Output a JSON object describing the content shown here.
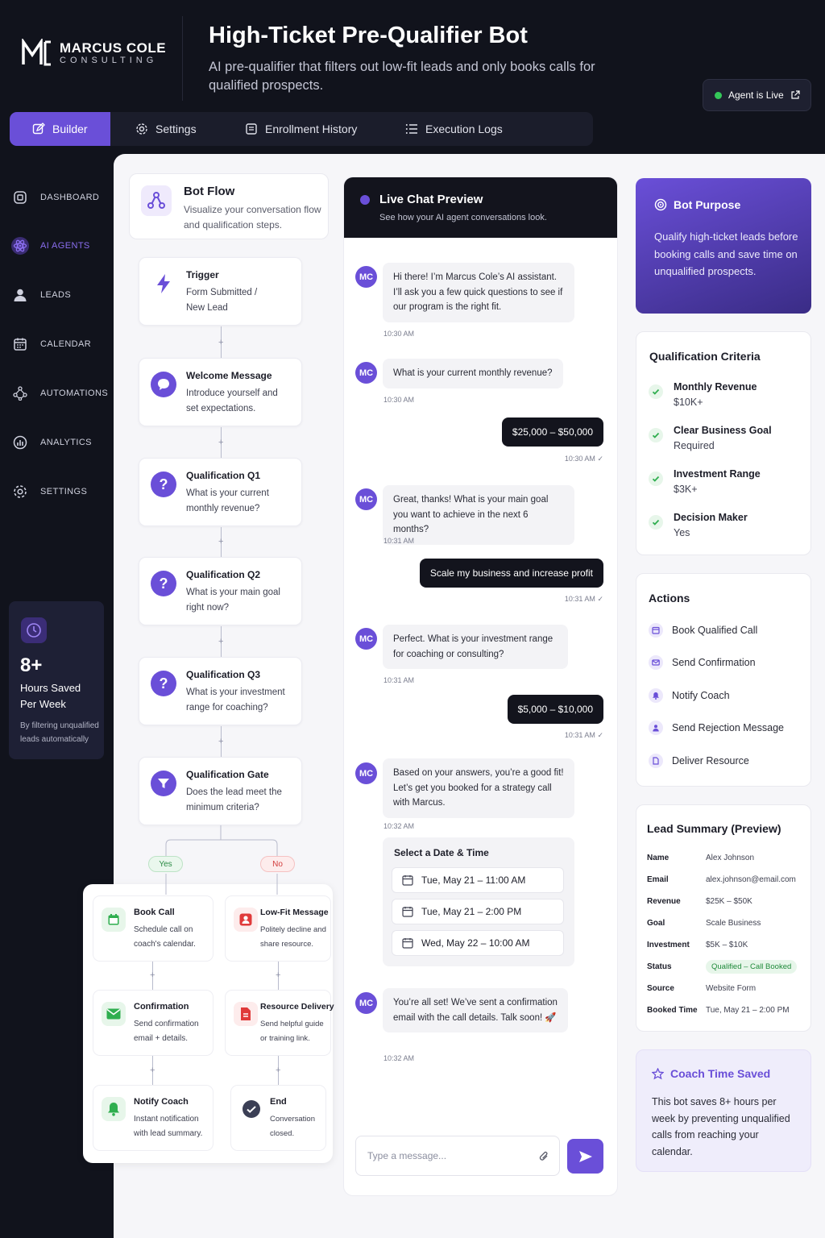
{
  "brand": {
    "name": "MARCUS COLE",
    "sub": "CONSULTING"
  },
  "header": {
    "title": "High-Ticket Pre-Qualifier Bot",
    "subtitle": "AI pre-qualifier that filters out low-fit leads and only books calls for qualified prospects.",
    "status": "Agent is Live"
  },
  "tabs": [
    {
      "label": "Builder",
      "icon": "edit-icon",
      "active": true
    },
    {
      "label": "Settings",
      "icon": "gear-icon"
    },
    {
      "label": "Enrollment History",
      "icon": "document-icon"
    },
    {
      "label": "Execution Logs",
      "icon": "list-icon"
    }
  ],
  "sidebar": {
    "items": [
      {
        "label": "DASHBOARD",
        "icon": "dashboard-icon"
      },
      {
        "label": "AI AGENTS",
        "icon": "atom-icon",
        "active": true
      },
      {
        "label": "LEADS",
        "icon": "user-icon"
      },
      {
        "label": "CALENDAR",
        "icon": "calendar-icon"
      },
      {
        "label": "AUTOMATIONS",
        "icon": "network-icon"
      },
      {
        "label": "ANALYTICS",
        "icon": "chart-icon"
      },
      {
        "label": "SETTINGS",
        "icon": "gear-icon"
      }
    ],
    "hours": {
      "value": "8+",
      "line1": "Hours Saved",
      "line2": "Per Week",
      "note": "By filtering unqualified leads automatically"
    }
  },
  "flow": {
    "title": "Bot Flow",
    "subtitle": "Visualize your conversation flow and qualification steps.",
    "steps": [
      {
        "title": "Trigger",
        "desc": "Form Submitted / New Lead",
        "icon": "bolt-icon"
      },
      {
        "title": "Welcome Message",
        "desc": "Introduce yourself and set expectations.",
        "icon": "chat-bubble-icon"
      },
      {
        "title": "Qualification Q1",
        "desc": "What is your current monthly revenue?",
        "icon": "question-icon"
      },
      {
        "title": "Qualification Q2",
        "desc": "What is your main goal right now?",
        "icon": "question-icon"
      },
      {
        "title": "Qualification Q3",
        "desc": "What is your investment range for coaching?",
        "icon": "question-icon"
      },
      {
        "title": "Qualification Gate",
        "desc": "Does the lead meet the minimum criteria?",
        "icon": "filter-icon"
      }
    ],
    "yes": "Yes",
    "no": "No",
    "yes_branch": [
      {
        "title": "Book Call",
        "desc": "Schedule call on coach's calendar.",
        "icon": "calendar-icon"
      },
      {
        "title": "Confirmation",
        "desc": "Send confirmation email + details.",
        "icon": "mail-icon"
      },
      {
        "title": "Notify Coach",
        "desc": "Instant notification with lead summary.",
        "icon": "bell-icon"
      }
    ],
    "no_branch": [
      {
        "title": "Low-Fit Message",
        "desc": "Politely decline and share resource.",
        "icon": "user-x-icon"
      },
      {
        "title": "Resource Delivery",
        "desc": "Send helpful guide or training link.",
        "icon": "file-icon"
      },
      {
        "title": "End",
        "desc": "Conversation closed.",
        "icon": "check-circle-icon"
      }
    ]
  },
  "chat": {
    "title": "Live Chat Preview",
    "subtitle": "See how your AI agent conversations look.",
    "avatar": "MC",
    "messages": [
      {
        "from": "bot",
        "text": "Hi there! I’m Marcus Cole’s AI assistant. I’ll ask you a few quick questions to see if our program is the right fit.",
        "time": "10:30 AM"
      },
      {
        "from": "bot",
        "text": "What is your current monthly revenue?",
        "time": "10:30 AM"
      },
      {
        "from": "user",
        "text": "$25,000 – $50,000",
        "time": "10:30 AM"
      },
      {
        "from": "bot",
        "text": "Great, thanks! What is your main goal you want to achieve in the next 6 months?",
        "time": "10:31 AM"
      },
      {
        "from": "user",
        "text": "Scale my business and increase profit",
        "time": "10:31 AM"
      },
      {
        "from": "bot",
        "text": "Perfect. What is your investment range for coaching or consulting?",
        "time": "10:31 AM"
      },
      {
        "from": "user",
        "text": "$5,000 – $10,000",
        "time": "10:31 AM"
      },
      {
        "from": "bot",
        "text": "Based on your answers, you’re a good fit! Let’s get you booked for a strategy call with Marcus.",
        "time": "10:32 AM"
      },
      {
        "from": "bot",
        "text": "You’re all set! We’ve sent a confirmation email with the call details. Talk soon! 🚀",
        "time": "10:32 AM"
      }
    ],
    "slots_title": "Select a Date & Time",
    "slots": [
      "Tue, May 21 – 11:00 AM",
      "Tue, May 21 – 2:00 PM",
      "Wed, May 22 – 10:00 AM"
    ],
    "input_placeholder": "Type a message..."
  },
  "purpose": {
    "title": "Bot Purpose",
    "body": "Qualify high-ticket leads before booking calls and save time on unqualified prospects."
  },
  "criteria": {
    "title": "Qualification Criteria",
    "items": [
      {
        "label": "Monthly Revenue",
        "value": "$10K+"
      },
      {
        "label": "Clear Business Goal",
        "value": "Required"
      },
      {
        "label": "Investment Range",
        "value": "$3K+"
      },
      {
        "label": "Decision Maker",
        "value": "Yes"
      }
    ]
  },
  "actions": {
    "title": "Actions",
    "items": [
      "Book Qualified Call",
      "Send Confirmation",
      "Notify Coach",
      "Send Rejection Message",
      "Deliver Resource"
    ]
  },
  "summary": {
    "title": "Lead Summary (Preview)",
    "rows": [
      {
        "key": "Name",
        "value": "Alex Johnson"
      },
      {
        "key": "Email",
        "value": "alex.johnson@email.com"
      },
      {
        "key": "Revenue",
        "value": "$25K – $50K"
      },
      {
        "key": "Goal",
        "value": "Scale Business"
      },
      {
        "key": "Investment",
        "value": "$5K – $10K"
      },
      {
        "key": "Status",
        "value": "Qualified – Call Booked"
      },
      {
        "key": "Source",
        "value": "Website Form"
      },
      {
        "key": "Booked Time",
        "value": "Tue, May 21 – 2:00 PM"
      }
    ]
  },
  "coach": {
    "title": "Coach Time Saved",
    "body": "This bot saves 8+ hours per week by preventing unqualified calls from reaching your calendar."
  },
  "colors": {
    "accent": "#6a4fd8",
    "dark": "#11131c",
    "success": "#34c759"
  }
}
